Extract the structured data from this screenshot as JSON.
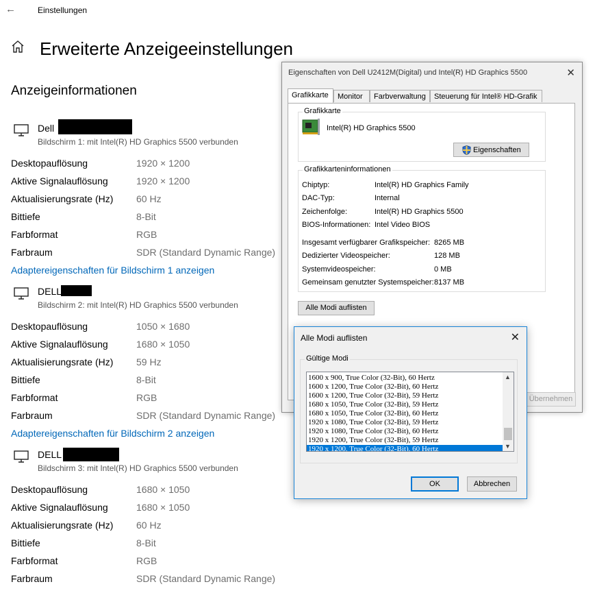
{
  "window": {
    "title": "Einstellungen"
  },
  "page": {
    "title": "Erweiterte Anzeigeeinstellungen",
    "section": "Anzeigeinformationen"
  },
  "labels": {
    "desktop_res": "Desktopauflösung",
    "signal_res": "Aktive Signalauflösung",
    "refresh": "Aktualisierungsrate (Hz)",
    "bitdepth": "Bittiefe",
    "color_format": "Farbformat",
    "color_space": "Farbraum"
  },
  "monitors": [
    {
      "name": "Dell",
      "sub": "Bildschirm 1: mit Intel(R) HD Graphics 5500 verbunden",
      "desktop_res": "1920 × 1200",
      "signal_res": "1920 × 1200",
      "refresh": "60 Hz",
      "bitdepth": "8-Bit",
      "color_format": "RGB",
      "color_space": "SDR (Standard Dynamic Range)",
      "link": "Adaptereigenschaften für Bildschirm 1 anzeigen"
    },
    {
      "name": "DELL",
      "sub": "Bildschirm 2: mit Intel(R) HD Graphics 5500 verbunden",
      "desktop_res": "1050 × 1680",
      "signal_res": "1680 × 1050",
      "refresh": "59 Hz",
      "bitdepth": "8-Bit",
      "color_format": "RGB",
      "color_space": "SDR (Standard Dynamic Range)",
      "link": "Adaptereigenschaften für Bildschirm 2 anzeigen"
    },
    {
      "name": "DELL",
      "sub": "Bildschirm 3: mit Intel(R) HD Graphics 5500 verbunden",
      "desktop_res": "1680 × 1050",
      "signal_res": "1680 × 1050",
      "refresh": "60 Hz",
      "bitdepth": "8-Bit",
      "color_format": "RGB",
      "color_space": "SDR (Standard Dynamic Range)"
    }
  ],
  "properties_dialog": {
    "title": "Eigenschaften von Dell U2412M(Digital) und Intel(R) HD Graphics 5500",
    "tabs": [
      "Grafikkarte",
      "Monitor",
      "Farbverwaltung",
      "Steuerung für Intel® HD-Grafik"
    ],
    "adapter_group": "Grafikkarte",
    "adapter_name": "Intel(R) HD Graphics 5500",
    "properties_button": "Eigenschaften",
    "info_group": "Grafikkarteninformationen",
    "info": [
      {
        "label": "Chiptyp:",
        "value": "Intel(R) HD Graphics Family"
      },
      {
        "label": "DAC-Typ:",
        "value": "Internal"
      },
      {
        "label": "Zeichenfolge:",
        "value": "Intel(R) HD Graphics 5500"
      },
      {
        "label": "BIOS-Informationen:",
        "value": "Intel Video BIOS"
      }
    ],
    "memory": [
      {
        "label": "Insgesamt verfügbarer Grafikspeicher:",
        "value": "8265 MB"
      },
      {
        "label": "Dedizierter Videospeicher:",
        "value": "128 MB"
      },
      {
        "label": "Systemvideospeicher:",
        "value": "0 MB"
      },
      {
        "label": "Gemeinsam genutzter Systemspeicher:",
        "value": "8137 MB"
      }
    ],
    "list_modes_button": "Alle Modi auflisten",
    "apply_button": "Übernehmen"
  },
  "modes_dialog": {
    "title": "Alle Modi auflisten",
    "group": "Gültige Modi",
    "modes": [
      "1600 x 900, True Color (32-Bit), 60 Hertz",
      "1600 x 1200, True Color (32-Bit), 60 Hertz",
      "1600 x 1200, True Color (32-Bit), 59 Hertz",
      "1680 x 1050, True Color (32-Bit), 59 Hertz",
      "1680 x 1050, True Color (32-Bit), 60 Hertz",
      "1920 x 1080, True Color (32-Bit), 59 Hertz",
      "1920 x 1080, True Color (32-Bit), 60 Hertz",
      "1920 x 1200, True Color (32-Bit), 59 Hertz",
      "1920 x 1200, True Color (32-Bit), 60 Hertz"
    ],
    "selected_index": 8,
    "ok_button": "OK",
    "cancel_button": "Abbrechen"
  },
  "colors": {
    "link": "#0067b8",
    "selection": "#0078d7",
    "value_text": "#6d6d6d"
  }
}
